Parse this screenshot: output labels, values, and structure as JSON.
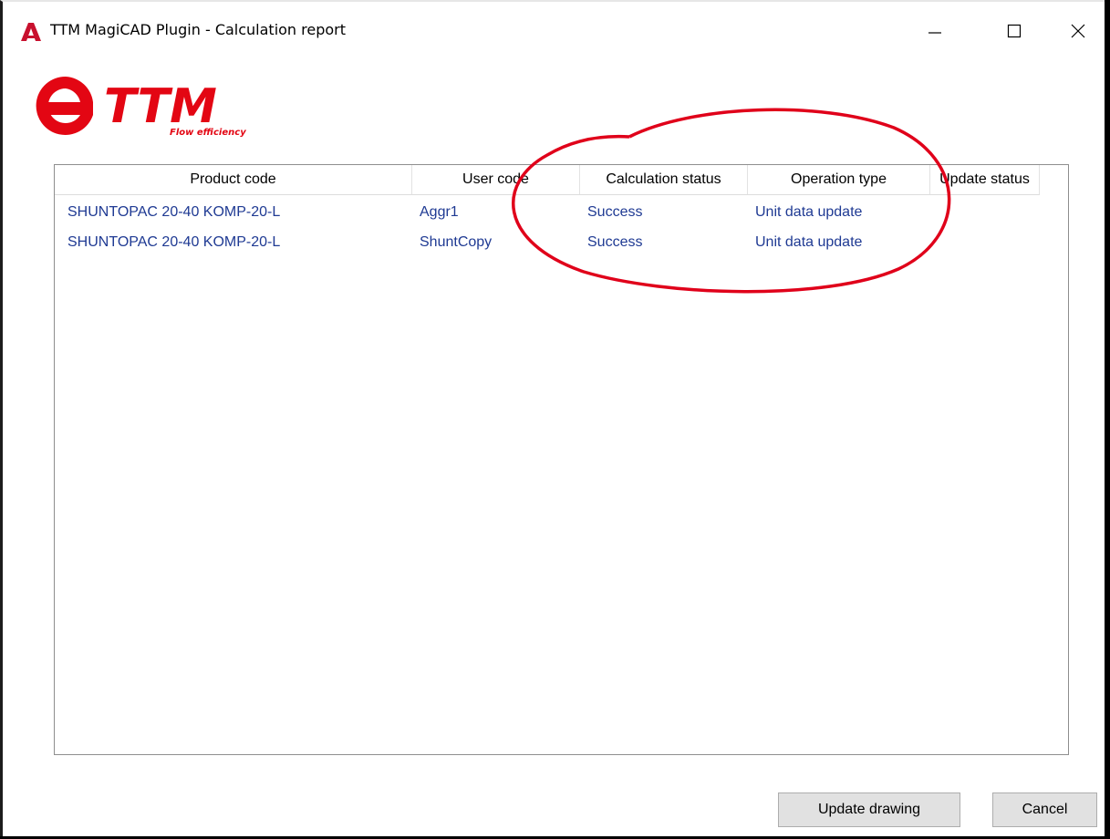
{
  "window": {
    "title": "TTM MagiCAD Plugin - Calculation report",
    "app_icon": "autocad-a-icon",
    "controls": [
      "minimize-icon",
      "maximize-icon",
      "close-icon"
    ]
  },
  "logo": {
    "brand": "TTM",
    "tagline": "Flow efficiency",
    "color": "#e30613"
  },
  "table": {
    "columns": [
      "Product code",
      "User code",
      "Calculation status",
      "Operation type",
      "Update status"
    ],
    "rows": [
      {
        "product_code": "SHUNTOPAC 20-40 KOMP-20-L",
        "user_code": "Aggr1",
        "calculation_status": "Success",
        "operation_type": "Unit data update",
        "update_status": ""
      },
      {
        "product_code": "SHUNTOPAC 20-40 KOMP-20-L",
        "user_code": "ShuntCopy",
        "calculation_status": "Success",
        "operation_type": "Unit data update",
        "update_status": ""
      }
    ]
  },
  "buttons": {
    "update_drawing": "Update drawing",
    "cancel": "Cancel"
  },
  "colors": {
    "cell_text": "#1f3a93",
    "annotation": "#e0001a"
  }
}
